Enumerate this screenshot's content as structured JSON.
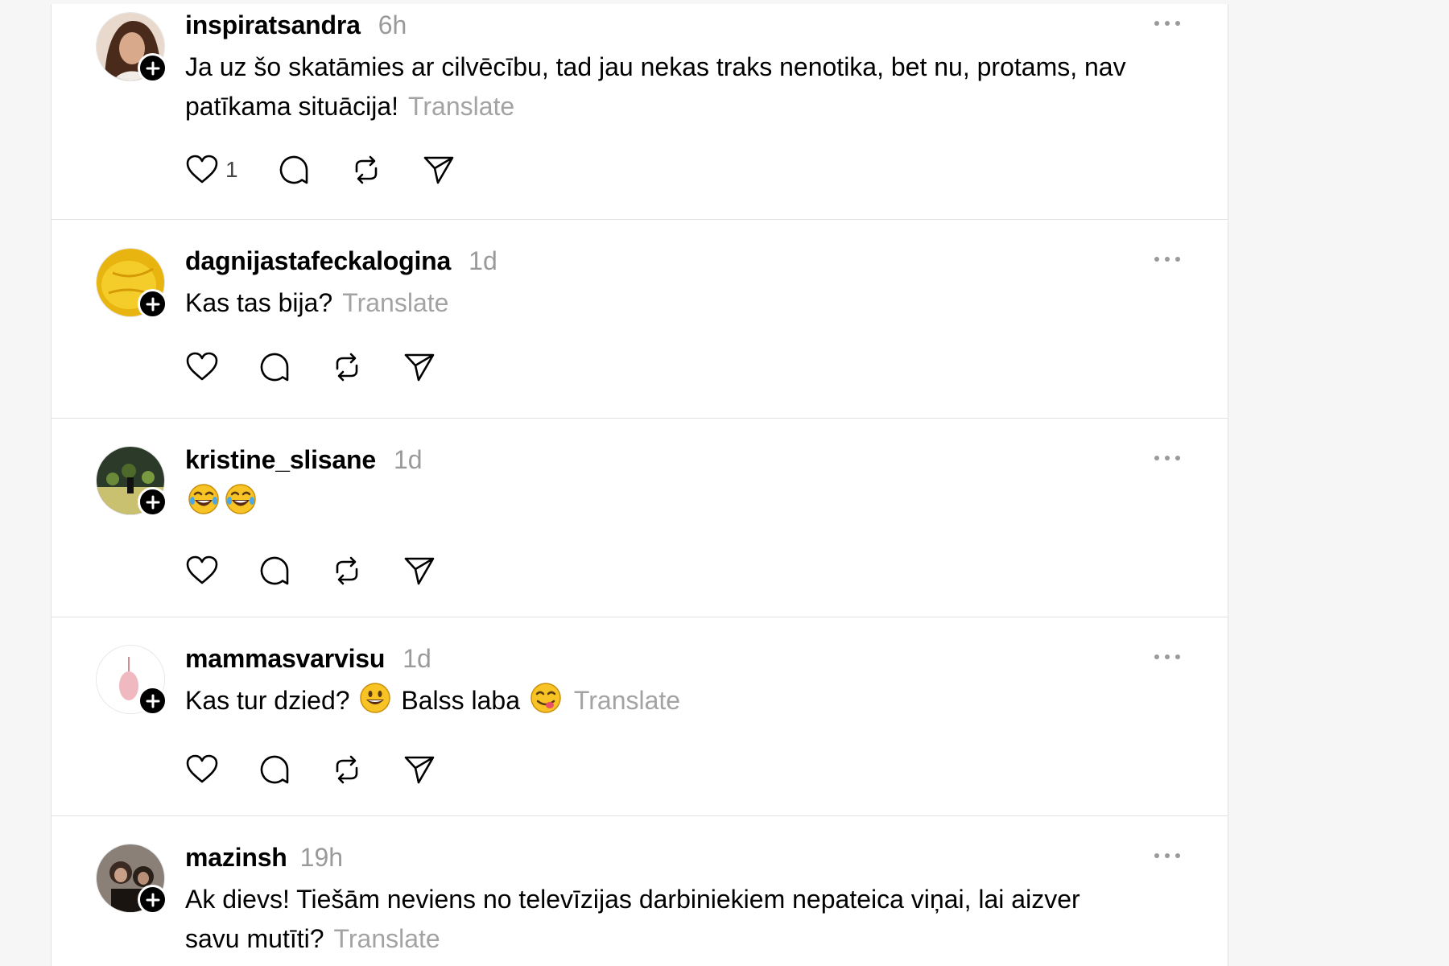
{
  "posts": [
    {
      "username": "inspiratsandra",
      "time": "6h",
      "text_line1": "Ja uz šo skatāmies ar cilvēcību, tad jau nekas traks nenotika, bet nu, protams, nav",
      "text_line2": "patīkama situācija!",
      "translate": "Translate",
      "like_count": "1"
    },
    {
      "username": "dagnijastafeckalogina",
      "time": "1d",
      "text": "Kas tas bija?",
      "translate": "Translate"
    },
    {
      "username": "kristine_slisane",
      "time": "1d",
      "emojis": [
        "laughing-tears-emoji",
        "laughing-tears-emoji"
      ]
    },
    {
      "username": "mammasvarvisu",
      "time": "1d",
      "text_part1": "Kas tur dzied?",
      "text_part2": "Balss laba",
      "translate": "Translate"
    },
    {
      "username": "mazinsh",
      "time": "19h",
      "text_line1": "Ak dievs! Tiešām neviens no televīzijas darbiniekiem nepateica viņai, lai aizver",
      "text_line2": "savu mutīti?",
      "translate": "Translate"
    }
  ],
  "icons": {
    "like": "heart-icon",
    "reply": "comment-icon",
    "repost": "repost-icon",
    "share": "share-icon",
    "more": "more-icon",
    "follow": "plus-icon"
  },
  "colors": {
    "text": "#000000",
    "muted": "#9a9a9a",
    "translate": "#a3a3a3",
    "divider": "#e0e0e0",
    "background": "#f6f6f6"
  }
}
